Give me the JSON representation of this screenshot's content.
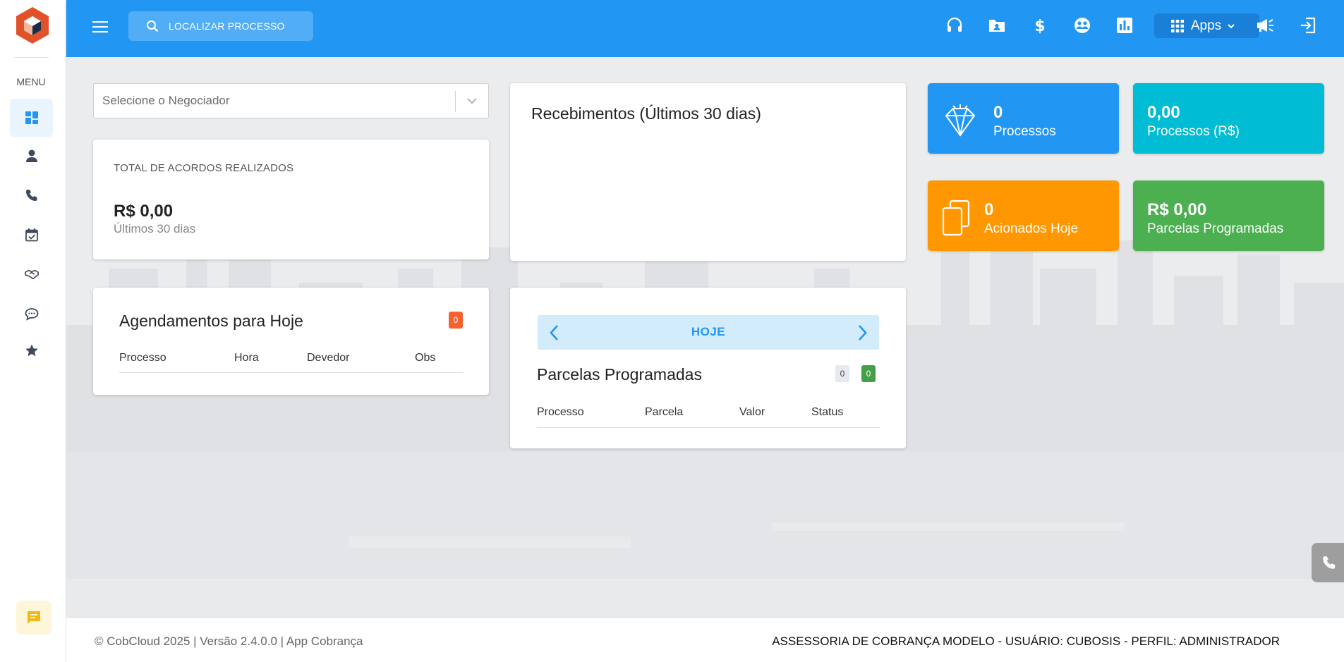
{
  "topbar": {
    "search_label": "LOCALIZAR PROCESSO",
    "apps_label": "Apps"
  },
  "sidebar": {
    "menu_label": "MENU"
  },
  "negociador_select": {
    "placeholder": "Selecione o Negociador"
  },
  "acordos_card": {
    "title": "TOTAL DE ACORDOS REALIZADOS",
    "value": "R$ 0,00",
    "period": "Últimos 30 dias"
  },
  "recebimentos_card": {
    "title": "Recebimentos (Últimos 30 dias)"
  },
  "agendamentos_card": {
    "title": "Agendamentos para Hoje",
    "badge": "0",
    "columns": [
      "Processo",
      "Hora",
      "Devedor",
      "Obs"
    ]
  },
  "parcelas_card": {
    "nav_label": "HOJE",
    "title": "Parcelas Programadas",
    "badge_grey": "0",
    "badge_green": "0",
    "columns": [
      "Processo",
      "Parcela",
      "Valor",
      "Status"
    ]
  },
  "tiles": [
    {
      "value": "0",
      "label": "Processos",
      "color": "#2196f3"
    },
    {
      "value": "0,00",
      "label": "Processos (R$)",
      "color": "#00bcd4"
    },
    {
      "value": "0",
      "label": "Acionados Hoje",
      "color": "#ff9800"
    },
    {
      "value": "R$ 0,00",
      "label": "Parcelas Programadas",
      "color": "#4caf50"
    }
  ],
  "footer": {
    "left": "© CobCloud 2025 | Versão 2.4.0.0 | App Cobrança",
    "right": "ASSESSORIA DE COBRANÇA MODELO - USUÁRIO: CUBOSIS - PERFIL: ADMINISTRADOR"
  }
}
